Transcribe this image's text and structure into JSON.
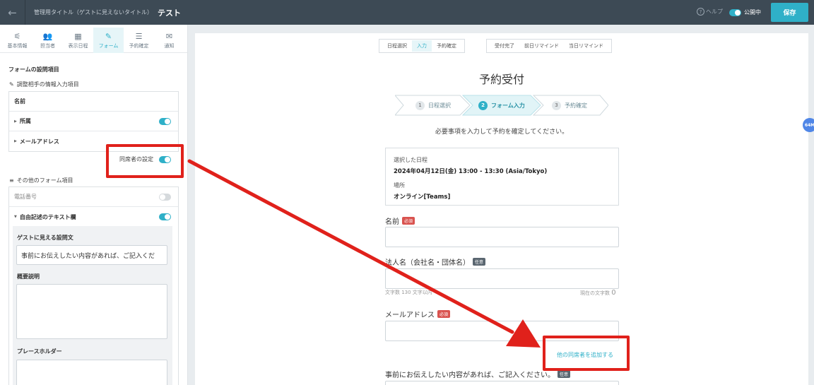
{
  "topbar": {
    "back_icon": "arrow-left-icon",
    "admin_title_label": "管理用タイトル（ゲストに見えないタイトル）",
    "page_name": "テスト",
    "help_label": "ヘルプ",
    "publish_label": "公開中",
    "publish_on": true,
    "save_label": "保存"
  },
  "left": {
    "tabs": [
      {
        "label": "基本情報",
        "icon": "sliders-icon"
      },
      {
        "label": "担当者",
        "icon": "users-icon"
      },
      {
        "label": "表示日程",
        "icon": "calendar-icon"
      },
      {
        "label": "フォーム",
        "icon": "form-icon",
        "active": true
      },
      {
        "label": "予約確定",
        "icon": "checklist-icon"
      },
      {
        "label": "通知",
        "icon": "mail-icon"
      }
    ],
    "form_items_title": "フォームの設問項目",
    "contact_section": "調整相手の情報入力項目",
    "contact_rows": [
      {
        "label": "名前"
      },
      {
        "label": "所属",
        "toggle": true
      },
      {
        "label": "メールアドレス"
      }
    ],
    "attendee_setting_label": "同席者の設定",
    "attendee_setting_on": true,
    "other_section": "その他のフォーム項目",
    "other_rows": [
      {
        "label": "電話番号",
        "toggle": false
      },
      {
        "label": "自由記述のテキスト欄",
        "toggle": true
      }
    ],
    "guest_question_label": "ゲストに見える設問文",
    "guest_question_value": "事前にお伝えしたい内容があれば、ご記入くだ",
    "summary_label": "概要説明",
    "placeholder_label": "プレースホルダー"
  },
  "right": {
    "view_tabs_group1": [
      "日程選択",
      "入力",
      "予約確定"
    ],
    "view_tabs_group1_active": "入力",
    "view_tabs_group2": [
      "受付完了",
      "前日リマインド",
      "当日リマインド"
    ],
    "headline": "予約受付",
    "progress_steps": [
      {
        "num": "1",
        "label": "日程選択"
      },
      {
        "num": "2",
        "label": "フォーム入力",
        "active": true
      },
      {
        "num": "3",
        "label": "予約確定"
      }
    ],
    "instruction": "必要事項を入力して予約を確定してください。",
    "schedule_label": "選択した日程",
    "schedule_value": "2024年04月12日(金) 13:00 - 13:30 (Asia/Tokyo)",
    "location_label": "場所",
    "location_value": "オンライン[Teams]",
    "name_label": "名前",
    "required_badge": "必須",
    "optional_badge": "任意",
    "company_label": "法人名（会社名・団体名）",
    "char_limit_note": "文字数 130 文字以内",
    "current_count_label": "現在の文字数",
    "current_count_value": "0",
    "email_label": "メールアドレス",
    "add_attendee_link": "他の同席者を追加する",
    "free_text_label": "事前にお伝えしたい内容があれば、ご記入ください。",
    "scroll_badge": "64M"
  },
  "colors": {
    "accent": "#2fb0c8",
    "topbar": "#3d4a55",
    "annotation": "#e0211b"
  }
}
